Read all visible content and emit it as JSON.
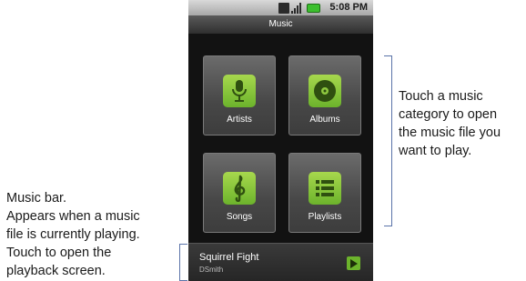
{
  "status_bar": {
    "time": "5:08 PM",
    "icons": [
      "usb-icon",
      "signal-icon",
      "battery-icon"
    ],
    "battery_color": "#3cbf2e"
  },
  "app": {
    "title": "Music"
  },
  "categories": [
    {
      "label": "Artists",
      "icon": "microphone-icon"
    },
    {
      "label": "Albums",
      "icon": "disc-icon"
    },
    {
      "label": "Songs",
      "icon": "treble-clef-icon"
    },
    {
      "label": "Playlists",
      "icon": "list-icon"
    }
  ],
  "music_bar": {
    "song": "Squirrel Fight",
    "artist": "DSmith",
    "play_icon": "play-icon"
  },
  "callouts": {
    "categories_text": "Touch a music\ncategory to open\nthe music file you\nwant to play.",
    "music_bar_text": "Music bar.\nAppears when a music\nfile is currently playing.\nTouch to open the\nplayback screen."
  },
  "colors": {
    "accent_green": "#6cb32c",
    "callout_line": "#5a73a8"
  }
}
